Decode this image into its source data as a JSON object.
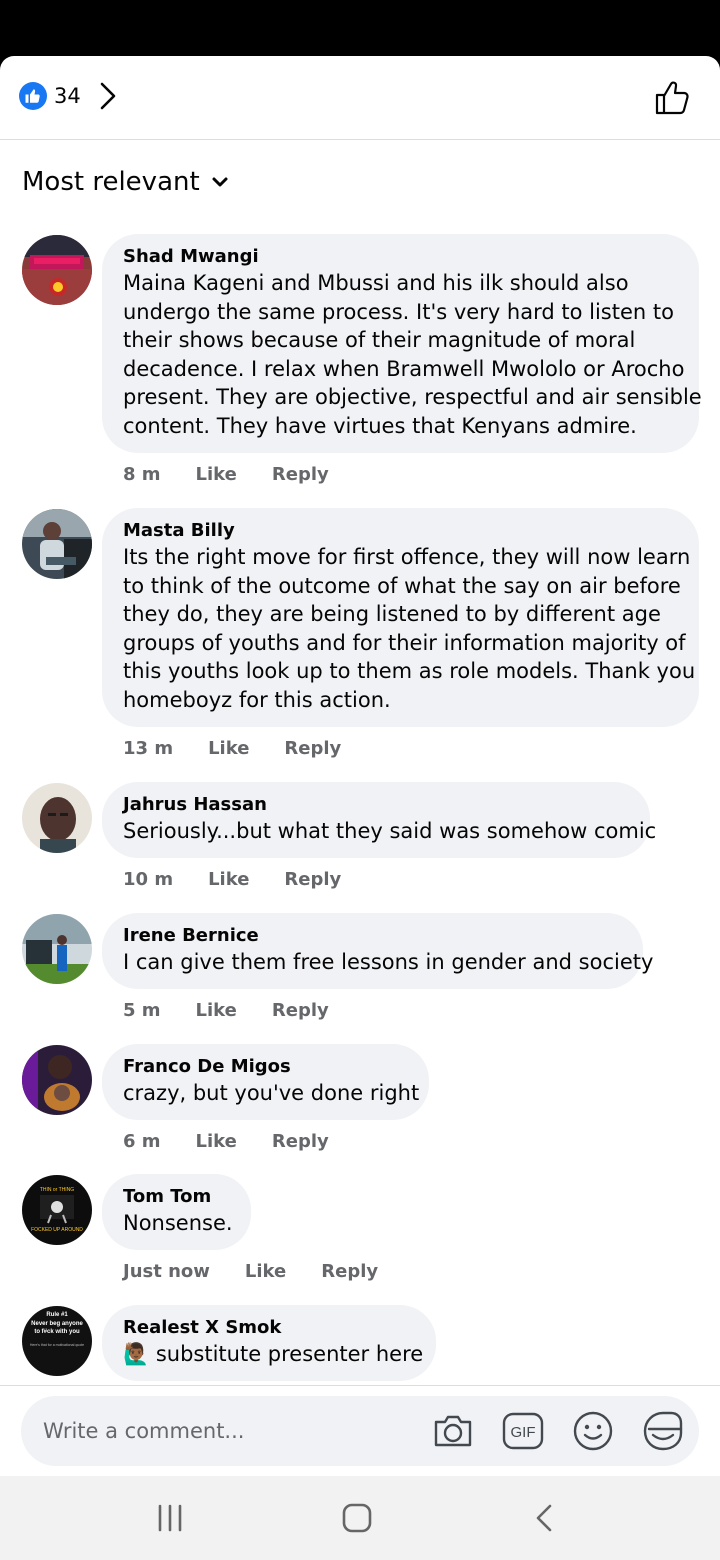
{
  "reactions": {
    "count": "34"
  },
  "sort": {
    "label": "Most relevant"
  },
  "comments": [
    {
      "author": "Shad Mwangi",
      "lines": [
        "Maina Kageni and Mbussi and his ilk should also",
        "undergo the same process. It's very hard to listen to",
        "their shows because of their magnitude of moral",
        "decadence. I relax  when Bramwell Mwololo or Arocho",
        "present. They are objective, respectful and air sensible",
        "content. They have virtues that Kenyans admire."
      ],
      "time": "8 m",
      "like": "Like",
      "reply": "Reply"
    },
    {
      "author": "Masta Billy",
      "lines": [
        "Its the right move for first offence, they will now learn",
        "to think of the outcome of what the say on air before",
        "they do, they are being listened to by different age",
        "groups of youths and for their information majority of",
        "this youths look up to them as role models. Thank you",
        "homeboyz for this action."
      ],
      "time": "13 m",
      "like": "Like",
      "reply": "Reply"
    },
    {
      "author": "Jahrus Hassan",
      "lines": [
        "Seriously...but what they said was somehow comic"
      ],
      "time": "10 m",
      "like": "Like",
      "reply": "Reply"
    },
    {
      "author": "Irene Bernice",
      "lines": [
        "I can give them free lessons in gender and society"
      ],
      "time": "5 m",
      "like": "Like",
      "reply": "Reply"
    },
    {
      "author": "Franco De Migos",
      "lines": [
        "crazy, but you've done right"
      ],
      "time": "6 m",
      "like": "Like",
      "reply": "Reply"
    },
    {
      "author": "Tom Tom",
      "lines": [
        "Nonsense."
      ],
      "time": "Just now",
      "like": "Like",
      "reply": "Reply"
    },
    {
      "author": "Realest X Smok",
      "lines": [
        "substitute presenter here"
      ],
      "emoji": "🙋🏾‍♂️"
    }
  ],
  "avatars": {
    "tom_tom_text": [
      "THIN or THING",
      "FOCKED UP AROUND"
    ],
    "realest_text": [
      "Rule #1",
      "Never beg anyone",
      "to f#ck with you",
      "Here's that for a motivational quote"
    ]
  },
  "composer": {
    "placeholder": "Write a comment...",
    "icons": [
      "camera-icon",
      "gif-icon",
      "emoji-icon",
      "sticker-icon"
    ],
    "gif_label": "GIF"
  },
  "colors": {
    "brand": "#1877f2",
    "bubble": "#f0f2f5",
    "meta": "#65676b"
  }
}
